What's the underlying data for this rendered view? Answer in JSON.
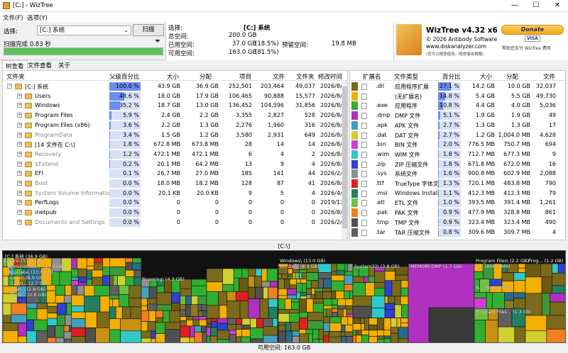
{
  "window": {
    "title": "[C:] - WizTree",
    "min": "—",
    "max": "☐",
    "close": "✕"
  },
  "menu": [
    "文件(F)",
    "选项(Y)"
  ],
  "scan": {
    "select_label": "选择:",
    "drive_value": "[C:] 系统",
    "scan_button": "扫描",
    "status": "扫描完成 0.83 秒",
    "progress": 1.0
  },
  "info": {
    "select_label": "选择:",
    "select_value": "[C:] 系统",
    "total_label": "总空间:",
    "total_value": "200.0 GB",
    "used_label": "已用空间:",
    "used_value": "37.0 GB",
    "used_pct": "(18.5%)",
    "free_label": "可用空间:",
    "free_value": "163.0 GB",
    "free_pct": "(81.5%)",
    "reserved_label": "预留空间:",
    "reserved_value": "19.8 MB"
  },
  "brand": {
    "name": "WizTree v4.32 x64",
    "copyright": "© 2026 Antibody Software",
    "url": "www.diskanalyzer.com",
    "tip": "(您可以随意使用，随意使用捐赠)",
    "donate": "Donate",
    "cards": "VISA",
    "donate_note": "帮助您支付 WizTree 费用"
  },
  "tabs": [
    "树查看",
    "文件查看",
    "关于"
  ],
  "tree": {
    "headers": [
      "文件夹",
      "父级百分比",
      "大小",
      "分配",
      "项目",
      "文件",
      "文件夹",
      "修改时间"
    ],
    "rows": [
      {
        "name": "[C:] 系统",
        "pct": "100.0 %",
        "pctv": 1.0,
        "size": "43.9 GB",
        "alloc": "36.9 GB",
        "items": "252,501",
        "files": "203,464",
        "folders": "49,037",
        "mod": "2026/8/",
        "level": 0,
        "gray": false
      },
      {
        "name": "Users",
        "pct": "48.6 %",
        "pctv": 0.486,
        "size": "18.0 GB",
        "alloc": "17.9 GB",
        "items": "106,465",
        "files": "90,888",
        "folders": "15,577",
        "mod": "2026/8/",
        "level": 1,
        "gray": false
      },
      {
        "name": "Windows",
        "pct": "35.2 %",
        "pctv": 0.352,
        "size": "18.7 GB",
        "alloc": "13.0 GB",
        "items": "136,452",
        "files": "104,596",
        "folders": "31,856",
        "mod": "2026/8/",
        "level": 1,
        "gray": false
      },
      {
        "name": "Program Files",
        "pct": "5.9 %",
        "pctv": 0.059,
        "size": "2.4 GB",
        "alloc": "2.2 GB",
        "items": "3,355",
        "files": "2,827",
        "folders": "528",
        "mod": "2026/8/",
        "level": 1,
        "gray": false
      },
      {
        "name": "Program Files (x86)",
        "pct": "3.6 %",
        "pctv": 0.036,
        "size": "2.2 GB",
        "alloc": "1.3 GB",
        "items": "2,276",
        "files": "1,960",
        "folders": "316",
        "mod": "2026/8/",
        "level": 1,
        "gray": false
      },
      {
        "name": "ProgramData",
        "pct": "3.4 %",
        "pctv": 0.034,
        "size": "1.5 GB",
        "alloc": "1.2 GB",
        "items": "3,580",
        "files": "2,931",
        "folders": "649",
        "mod": "2026/8/",
        "level": 1,
        "gray": true
      },
      {
        "name": "[14 文件在 C:\\]",
        "pct": "1.8 %",
        "pctv": 0.018,
        "size": "672.8 MB",
        "alloc": "673.8 MB",
        "items": "28",
        "files": "14",
        "folders": "14",
        "mod": "2026/8/",
        "level": 1,
        "gray": false
      },
      {
        "name": "Recovery",
        "pct": "1.2 %",
        "pctv": 0.012,
        "size": "472.1 MB",
        "alloc": "472.1 MB",
        "items": "6",
        "files": "4",
        "folders": "2",
        "mod": "2026/8/",
        "level": 1,
        "gray": true
      },
      {
        "name": "$Extend",
        "pct": "0.2 %",
        "pctv": 0.002,
        "size": "20.1 MB",
        "alloc": "64.2 MB",
        "items": "13",
        "files": "9",
        "folders": "4",
        "mod": "2026/8/",
        "level": 1,
        "gray": true
      },
      {
        "name": "EFI",
        "pct": "0.1 %",
        "pctv": 0.001,
        "size": "26.7 MB",
        "alloc": "27.0 MB",
        "items": "185",
        "files": "141",
        "folders": "44",
        "mod": "2026/2/",
        "level": 1,
        "gray": false
      },
      {
        "name": "Boot",
        "pct": "0.0 %",
        "pctv": 0.0,
        "size": "18.0 MB",
        "alloc": "18.2 MB",
        "items": "128",
        "files": "87",
        "folders": "41",
        "mod": "2026/8/",
        "level": 1,
        "gray": true
      },
      {
        "name": "System Volume Information",
        "pct": "0.0 %",
        "pctv": 0.0,
        "size": "20.1 KB",
        "alloc": "20.0 KB",
        "items": "9",
        "files": "5",
        "folders": "4",
        "mod": "2026/4/",
        "level": 1,
        "gray": true
      },
      {
        "name": "PerfLogs",
        "pct": "0.0 %",
        "pctv": 0.0,
        "size": "0",
        "alloc": "0",
        "items": "0",
        "files": "0",
        "folders": "0",
        "mod": "2019/12",
        "level": 1,
        "gray": false
      },
      {
        "name": "inetpub",
        "pct": "0.0 %",
        "pctv": 0.0,
        "size": "0",
        "alloc": "0",
        "items": "0",
        "files": "0",
        "folders": "0",
        "mod": "2026/8/",
        "level": 1,
        "gray": false
      },
      {
        "name": "Documents and Settings",
        "pct": "0.0 %",
        "pctv": 0.0,
        "size": "0",
        "alloc": "0",
        "items": "0",
        "files": "0",
        "folders": "0",
        "mod": "2026/2/",
        "level": 1,
        "gray": true
      }
    ]
  },
  "types": {
    "headers": [
      "扩展名",
      "文件类型",
      "百分比",
      "大小",
      "分配",
      "文件"
    ],
    "rows": [
      {
        "color": "#7a6a1a",
        "ext": ".dll",
        "type": "应用程序扩展",
        "pct": "27.1 %",
        "pctv": 0.271,
        "size": "14.2 GB",
        "alloc": "10.0 GB",
        "files": "32,037"
      },
      {
        "color": "#f4b000",
        "ext": "",
        "type": "(无扩展名)",
        "pct": "14.8 %",
        "pctv": 0.148,
        "size": "5.4 GB",
        "alloc": "5.5 GB",
        "files": "49,730"
      },
      {
        "color": "#30b030",
        "ext": ".exe",
        "type": "应用程序",
        "pct": "10.8 %",
        "pctv": 0.108,
        "size": "4.4 GB",
        "alloc": "4.0 GB",
        "files": "5,036"
      },
      {
        "color": "#b030c0",
        "ext": ".dmp",
        "type": "DMP 文件",
        "pct": "5.1 %",
        "pctv": 0.051,
        "size": "1.9 GB",
        "alloc": "1.9 GB",
        "files": "49"
      },
      {
        "color": "#40a0c0",
        "ext": ".apk",
        "type": "APK 文件",
        "pct": "2.7 %",
        "pctv": 0.027,
        "size": "1.3 GB",
        "alloc": "1.3 GB",
        "files": "17"
      },
      {
        "color": "#d0d030",
        "ext": ".dat",
        "type": "DAT 文件",
        "pct": "2.7 %",
        "pctv": 0.027,
        "size": "1.2 GB",
        "alloc": "1,004.0 MB",
        "files": "4,628"
      },
      {
        "color": "#d040d0",
        "ext": ".bin",
        "type": "BIN 文件",
        "pct": "2.0 %",
        "pctv": 0.02,
        "size": "776.5 MB",
        "alloc": "750.7 MB",
        "files": "694"
      },
      {
        "color": "#30c8c8",
        "ext": ".wim",
        "type": "WIM 文件",
        "pct": "1.8 %",
        "pctv": 0.018,
        "size": "712.7 MB",
        "alloc": "677.3 MB",
        "files": "9"
      },
      {
        "color": "#3040d0",
        "ext": ".zip",
        "type": "ZIP 压缩文件",
        "pct": "1.8 %",
        "pctv": 0.018,
        "size": "671.8 MB",
        "alloc": "672.0 MB",
        "files": "16"
      },
      {
        "color": "#909090",
        "ext": ".sys",
        "type": "系统文件",
        "pct": "1.6 %",
        "pctv": 0.016,
        "size": "900.8 MB",
        "alloc": "602.9 MB",
        "files": "2,088"
      },
      {
        "color": "#e02020",
        "ext": ".ttf",
        "type": "TrueType 字体文",
        "pct": "1.3 %",
        "pctv": 0.013,
        "size": "720.1 MB",
        "alloc": "483.8 MB",
        "files": "790"
      },
      {
        "color": "#208060",
        "ext": ".msi",
        "type": "Windows Installe",
        "pct": "1.1 %",
        "pctv": 0.011,
        "size": "412.3 MB",
        "alloc": "412.3 MB",
        "files": "79"
      },
      {
        "color": "#70c040",
        "ext": ".etl",
        "type": "ETL 文件",
        "pct": "1.0 %",
        "pctv": 0.01,
        "size": "393.5 MB",
        "alloc": "391.4 MB",
        "files": "1,261"
      },
      {
        "color": "#f08020",
        "ext": ".pak",
        "type": "PAK 文件",
        "pct": "0.9 %",
        "pctv": 0.009,
        "size": "477.9 MB",
        "alloc": "328.8 MB",
        "files": "861"
      },
      {
        "color": "#505050",
        "ext": ".tmp",
        "type": "TMP 文件",
        "pct": "0.9 %",
        "pctv": 0.009,
        "size": "323.4 MB",
        "alloc": "323.4 MB",
        "files": "490"
      },
      {
        "color": "#606060",
        "ext": ".tar",
        "type": "TAR 压缩文件",
        "pct": "0.8 %",
        "pctv": 0.008,
        "size": "309.6 MB",
        "alloc": "309.7 MB",
        "files": "4"
      }
    ]
  },
  "treemap": {
    "path": "[C:\\]",
    "labels": [
      "[C:] 系统 (36.9 GB)",
      "Users\\ (17.9 GB)",
      "Administrato... (17.9 GB)",
      "AppData\\ (13.0 GB)",
      "Local\\ (8.9 GB)",
      "Centr... (2.7 GB)",
      "User... (2.8 GB)",
      "Defa... (2.6 GB)",
      "Roaming\\ (4.3 GB)",
      "Windows\\ (13.0 GB)",
      "WinSxS\\ (4.9 GB)",
      "System32\\ (3.8 GB)",
      "MEMORY.DMP (1.7 GB)",
      "Program Files\\ (2.2 GB)",
      "C... (806.7 MB)",
      "N... (806.4 MB)",
      "Program Files... (1.3 GB)",
      "Prog... (1.2 GB)"
    ]
  },
  "status": "可用空间: 163.0 GB"
}
